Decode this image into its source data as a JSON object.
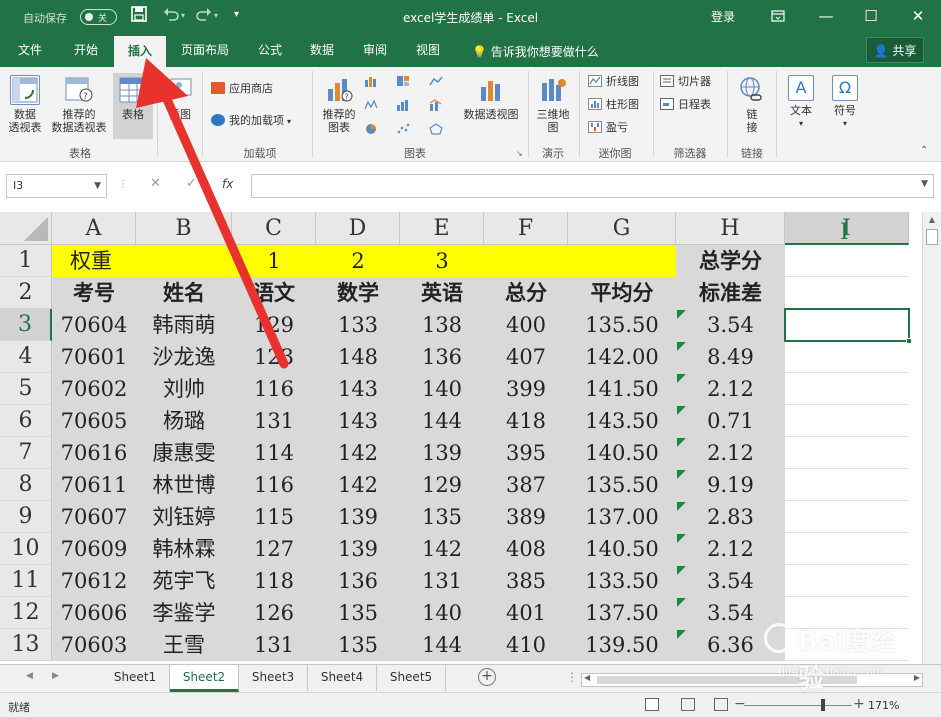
{
  "titlebar": {
    "autosave_label": "自动保存",
    "autosave_state": "关",
    "title": "excel学生成绩单 - Excel",
    "login": "登录"
  },
  "menu": {
    "tabs": [
      {
        "label": "文件"
      },
      {
        "label": "开始"
      },
      {
        "label": "插入"
      },
      {
        "label": "页面布局"
      },
      {
        "label": "公式"
      },
      {
        "label": "数据"
      },
      {
        "label": "审阅"
      },
      {
        "label": "视图"
      }
    ],
    "tellme": "告诉我你想要做什么",
    "share": "共享"
  },
  "ribbon": {
    "pivot_table": "数据\n透视表",
    "recommended_pivot": "推荐的\n数据透视表",
    "table": "表格",
    "group_tables": "表格",
    "illustrations": "插图",
    "app_store": "应用商店",
    "my_addins": "我的加载项",
    "group_addins": "加载项",
    "recommended_charts": "推荐的\n图表",
    "group_charts": "图表",
    "pivot_chart": "数据透视图",
    "map_3d": "三维地\n图",
    "group_tours": "演示",
    "spark_line": "折线图",
    "spark_column": "柱形图",
    "spark_winloss": "盈亏",
    "group_sparklines": "迷你图",
    "slicer": "切片器",
    "timeline": "日程表",
    "group_filters": "筛选器",
    "link": "链\n接",
    "group_links": "链接",
    "text": "文本",
    "symbol": "符号"
  },
  "formula_bar": {
    "name_box": "I3",
    "fx": "fx",
    "value": ""
  },
  "sheet": {
    "columns": [
      "A",
      "B",
      "C",
      "D",
      "E",
      "F",
      "G",
      "H",
      "I"
    ],
    "row_numbers": [
      "1",
      "2",
      "3",
      "4",
      "5",
      "6",
      "7",
      "8",
      "9",
      "10",
      "11",
      "12",
      "13"
    ],
    "row1": [
      "权重",
      "",
      "1",
      "2",
      "3",
      "",
      "",
      "总学分",
      ""
    ],
    "row2": [
      "考号",
      "姓名",
      "语文",
      "数学",
      "英语",
      "总分",
      "平均分",
      "标准差",
      ""
    ],
    "data_rows": [
      [
        "70604",
        "韩雨萌",
        "129",
        "133",
        "138",
        "400",
        "135.50",
        "3.54"
      ],
      [
        "70601",
        "沙龙逸",
        "123",
        "148",
        "136",
        "407",
        "142.00",
        "8.49"
      ],
      [
        "70602",
        "刘帅",
        "116",
        "143",
        "140",
        "399",
        "141.50",
        "2.12"
      ],
      [
        "70605",
        "杨璐",
        "131",
        "143",
        "144",
        "418",
        "143.50",
        "0.71"
      ],
      [
        "70616",
        "康惠雯",
        "114",
        "142",
        "139",
        "395",
        "140.50",
        "2.12"
      ],
      [
        "70611",
        "林世博",
        "116",
        "142",
        "129",
        "387",
        "135.50",
        "9.19"
      ],
      [
        "70607",
        "刘钰婷",
        "115",
        "139",
        "135",
        "389",
        "137.00",
        "2.83"
      ],
      [
        "70609",
        "韩林霖",
        "127",
        "139",
        "142",
        "408",
        "140.50",
        "2.12"
      ],
      [
        "70612",
        "苑宇飞",
        "118",
        "136",
        "131",
        "385",
        "133.50",
        "3.54"
      ],
      [
        "70606",
        "李鉴学",
        "126",
        "135",
        "140",
        "401",
        "137.50",
        "3.54"
      ],
      [
        "70603",
        "王雪",
        "131",
        "135",
        "144",
        "410",
        "139.50",
        "6.36"
      ]
    ]
  },
  "sheet_tabs": [
    "Sheet1",
    "Sheet2",
    "Sheet3",
    "Sheet4",
    "Sheet5"
  ],
  "active_sheet": "Sheet2",
  "status": {
    "ready": "就绪",
    "zoom": "171%"
  },
  "watermark": {
    "brand": "Bai度经验",
    "url": "jingyan.baidu.com"
  },
  "colors": {
    "excel_green": "#217346",
    "highlight_yellow": "#ffff00",
    "data_fill": "#d9d9d9",
    "arrow_red": "#e8322e"
  }
}
